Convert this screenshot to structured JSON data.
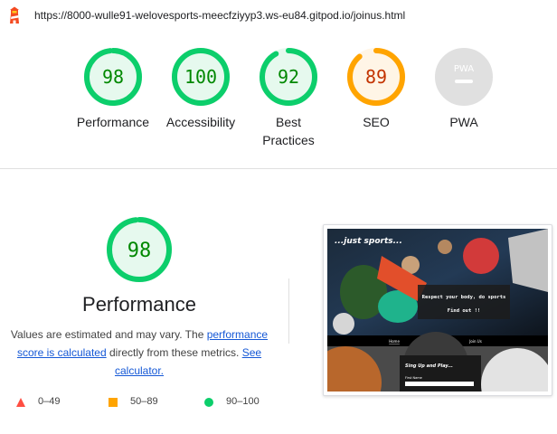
{
  "url": "https://8000-wulle91-welovesports-meecfziyyp3.ws-eu84.gitpod.io/joinus.html",
  "colors": {
    "pass": "#0cce6b",
    "pass_text": "#008800",
    "pass_fill": "#e6f9ee",
    "average": "#ffa400",
    "average_text": "#c33300",
    "average_fill": "#fff5e6",
    "fail": "#ff4e42",
    "na": "#e0e0e0"
  },
  "categories": [
    {
      "label": "Performance",
      "score": "98",
      "value": 0.98,
      "rating": "pass"
    },
    {
      "label": "Accessibility",
      "score": "100",
      "value": 1.0,
      "rating": "pass"
    },
    {
      "label": "Best Practices",
      "score": "92",
      "value": 0.92,
      "rating": "pass"
    },
    {
      "label": "SEO",
      "score": "89",
      "value": 0.89,
      "rating": "average"
    },
    {
      "label": "PWA",
      "score": "",
      "value": 0,
      "rating": "na",
      "badge": "PWA"
    }
  ],
  "performance": {
    "score": "98",
    "value": 0.98,
    "title": "Performance",
    "desc_prefix": "Values are estimated and may vary. The ",
    "desc_link1": "performance score is calculated",
    "desc_mid": " directly from these metrics. ",
    "desc_link2": "See calculator."
  },
  "legend": [
    {
      "shape": "triangle",
      "range": "0–49",
      "color": "#ff4e42"
    },
    {
      "shape": "square",
      "range": "50–89",
      "color": "#ffa400"
    },
    {
      "shape": "circle",
      "range": "90–100",
      "color": "#0cce6b"
    }
  ],
  "thumbnail": {
    "hero_title": "...just sports...",
    "hero_text": "Respect your body, do sports",
    "hero_cta": "Find out !!",
    "nav": [
      "Home",
      "Locations",
      "Join Us"
    ],
    "form_title": "Sing Up and Play...",
    "form_field": "First Name"
  }
}
